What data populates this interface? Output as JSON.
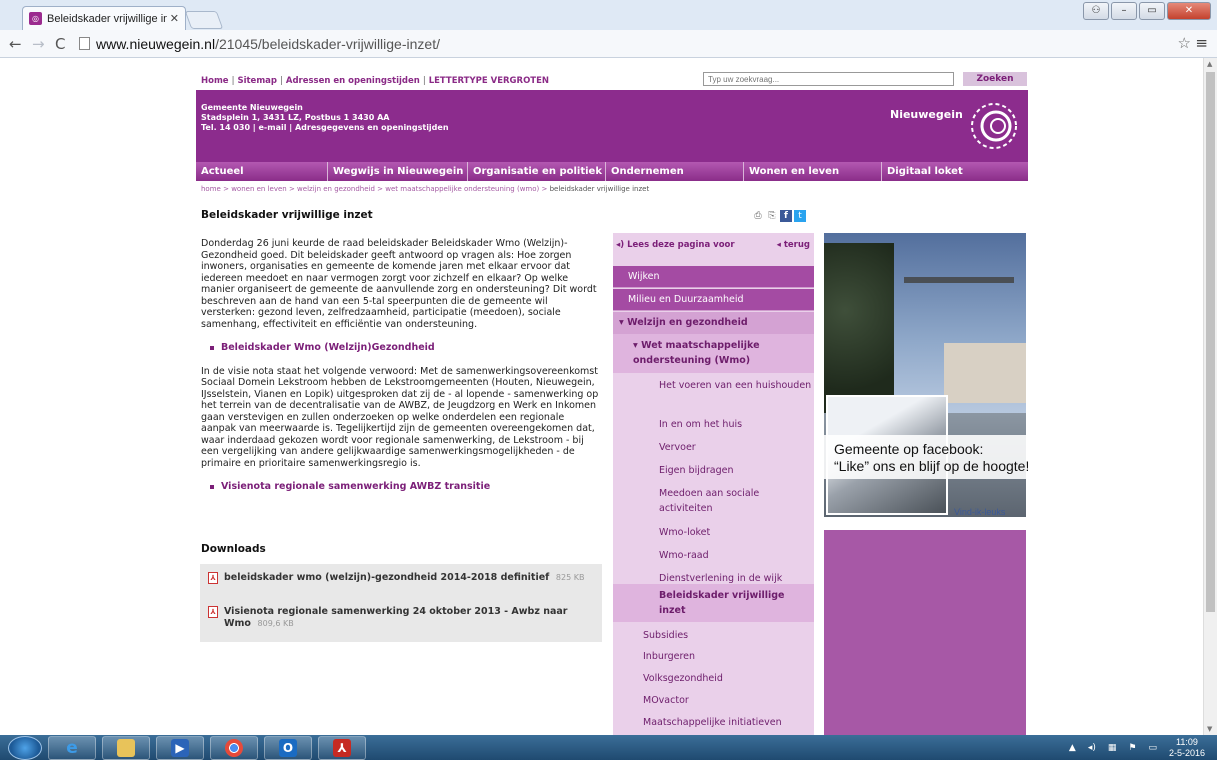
{
  "browser": {
    "tab_title": "Beleidskader vrijwillige inz",
    "url_host": "www.nieuwegein.nl",
    "url_path": "/21045/beleidskader-vrijwillige-inzet/"
  },
  "site": {
    "utility_links": [
      "Home",
      "Sitemap",
      "Adressen en openingstijden",
      "LETTERTYPE VERGROTEN"
    ],
    "search": {
      "placeholder": "Typ uw zoekvraag...",
      "button": "Zoeken"
    },
    "address": {
      "line1": "Gemeente Nieuwegein",
      "line2": "Stadsplein 1, 3431 LZ, Postbus 1 3430 AA",
      "line3": "Tel. 14 030 | e-mail | Adresgegevens en openingstijden"
    },
    "brand": "Nieuwegein",
    "nav": [
      "Actueel",
      "Wegwijs in Nieuwegein",
      "Organisatie en politiek",
      "Ondernemen",
      "Wonen en leven",
      "Digitaal loket"
    ],
    "breadcrumb": [
      "home",
      "wonen en leven",
      "welzijn en gezondheid",
      "wet maatschappelijke ondersteuning (wmo)",
      "beleidskader vrijwillige inzet"
    ],
    "page_title": "Beleidskader vrijwillige inzet",
    "article": {
      "p1": "Donderdag 26 juni keurde de raad beleidskader Beleidskader Wmo (Welzijn)-Gezondheid goed. Dit beleidskader geeft antwoord op vragen als: Hoe zorgen inwoners, organisaties en gemeente de komende jaren met elkaar ervoor dat iedereen meedoet en naar vermogen zorgt voor zichzelf en elkaar? Op welke manier organiseert de gemeente de aanvullende zorg en ondersteuning? Dit wordt beschreven aan de hand van een 5-tal speerpunten die de gemeente wil versterken: gezond leven, zelfredzaamheid, participatie (meedoen), sociale samenhang, effectiviteit en efficiëntie van ondersteuning.",
      "link1": "Beleidskader Wmo (Welzijn)Gezondheid",
      "p2": "In de visie nota staat het volgende verwoord: Met de samenwerkingsovereenkomst Sociaal Domein Lekstroom hebben de Lekstroomgemeenten (Houten, Nieuwegein, IJsselstein, Vianen en Lopik) uitgesproken dat zij de - al lopende - samenwerking op het terrein van de decentralisatie van de AWBZ, de Jeugdzorg en Werk en Inkomen gaan verstevigen en zullen onderzoeken op welke onderdelen een regionale aanpak van meerwaarde is. Tegelijkertijd zijn de gemeenten overeengekomen dat, waar inderdaad gekozen wordt voor regionale samenwerking, de Lekstroom - bij een vergelijking van andere gelijkwaardige samenwerkingsmogelijkheden - de primaire en prioritaire samenwerkingsregio is.",
      "link2": "Visienota regionale samenwerking AWBZ transitie"
    },
    "downloads": {
      "heading": "Downloads",
      "items": [
        {
          "name": "beleidskader wmo (welzijn)-gezondheid 2014-2018 definitief",
          "size": "825 KB"
        },
        {
          "name": "Visienota regionale samenwerking 24 oktober 2013 - Awbz naar Wmo",
          "size": "809,6 KB"
        }
      ]
    },
    "subnav": {
      "read_aloud": "Lees deze pagina voor",
      "back": "terug",
      "items": [
        "Wijken",
        "Milieu en Duurzaamheid",
        "Welzijn en gezondheid",
        "Wet maatschappelijke ondersteuning (Wmo)",
        "Het voeren van een huishouden",
        "In en om het huis",
        "Vervoer",
        "Eigen bijdragen",
        "Meedoen aan sociale activiteiten",
        "Wmo-loket",
        "Wmo-raad",
        "Dienstverlening in de wijk",
        "Beleidskader vrijwillige inzet",
        "Subsidies",
        "Inburgeren",
        "Volksgezondheid",
        "MOvactor",
        "Maatschappelijke initiatieven"
      ]
    },
    "facebook": {
      "line1": "Gemeente op facebook:",
      "line2": "“Like” ons en blijf op de hoogte!",
      "like": "Vind-ik-leuks"
    }
  },
  "taskbar": {
    "time": "11:09",
    "date": "2-5-2016"
  },
  "colors": {
    "brand_purple": "#8c2c8d",
    "nav_purple": "#a44ba3",
    "sub_bg": "#ead0ea"
  }
}
